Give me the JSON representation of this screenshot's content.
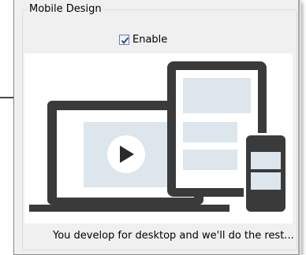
{
  "groupbox": {
    "title": "Mobile Design"
  },
  "enable_checkbox": {
    "label": "Enable",
    "checked": true
  },
  "illustration": {
    "description_icons": [
      "laptop-icon",
      "tablet-icon",
      "phone-icon",
      "play-icon"
    ]
  },
  "caption": "You develop for desktop and we'll do the rest...",
  "colors": {
    "panel_bg": "#f0f0f0",
    "device_frame": "#3a3a3a",
    "screen_block": "#dde6ec",
    "play_circle": "#ffffff",
    "checkmark": "#2b4a8a"
  }
}
